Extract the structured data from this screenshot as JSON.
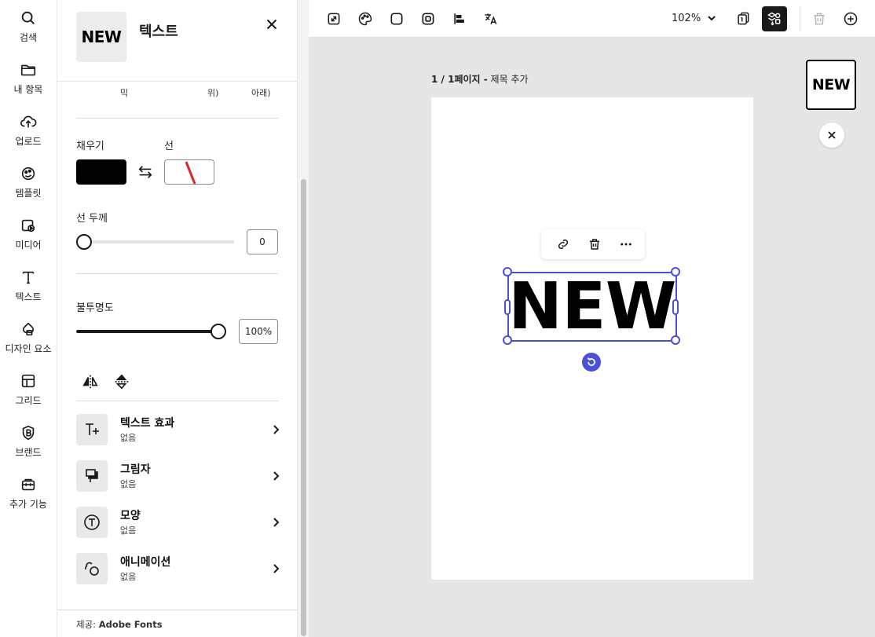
{
  "rail": {
    "items": [
      {
        "label": "검색",
        "icon": "search-icon"
      },
      {
        "label": "내 항목",
        "icon": "folder-icon"
      },
      {
        "label": "업로드",
        "icon": "cloud-upload-icon"
      },
      {
        "label": "템플릿",
        "icon": "template-icon"
      },
      {
        "label": "미디어",
        "icon": "media-icon"
      },
      {
        "label": "텍스트",
        "icon": "text-icon"
      },
      {
        "label": "디자인 요소",
        "icon": "shapes-icon"
      },
      {
        "label": "그리드",
        "icon": "grid-icon"
      },
      {
        "label": "브랜드",
        "icon": "brand-icon"
      },
      {
        "label": "추가 기능",
        "icon": "addons-icon"
      }
    ]
  },
  "panel": {
    "thumb_text": "NEW",
    "title": "텍스트",
    "cut_labels": [
      "믹",
      "위)",
      "아래)"
    ],
    "fill_label": "채우기",
    "stroke_label": "선",
    "fill_color": "#000000",
    "stroke_width_label": "선 두께",
    "stroke_width_value": "0",
    "stroke_width_fraction": 0,
    "opacity_label": "불투명도",
    "opacity_value": "100%",
    "opacity_fraction": 1,
    "rows": [
      {
        "title": "텍스트 효과",
        "sub": "없음",
        "icon": "text-effects-icon"
      },
      {
        "title": "그림자",
        "sub": "없음",
        "icon": "shadow-icon"
      },
      {
        "title": "모양",
        "sub": "없음",
        "icon": "shape-icon"
      },
      {
        "title": "애니메이션",
        "sub": "없음",
        "icon": "animation-icon"
      }
    ],
    "provider_label": "제공:",
    "provider_name": "Adobe Fonts"
  },
  "toolbar": {
    "zoom": "102%"
  },
  "canvas": {
    "page_counter": "1 / 1페이지 -",
    "page_title": "제목 추가",
    "text": "NEW",
    "preview_text": "NEW"
  },
  "colors": {
    "selection": "#4a50d8",
    "stroke_slash": "#d9252a"
  }
}
